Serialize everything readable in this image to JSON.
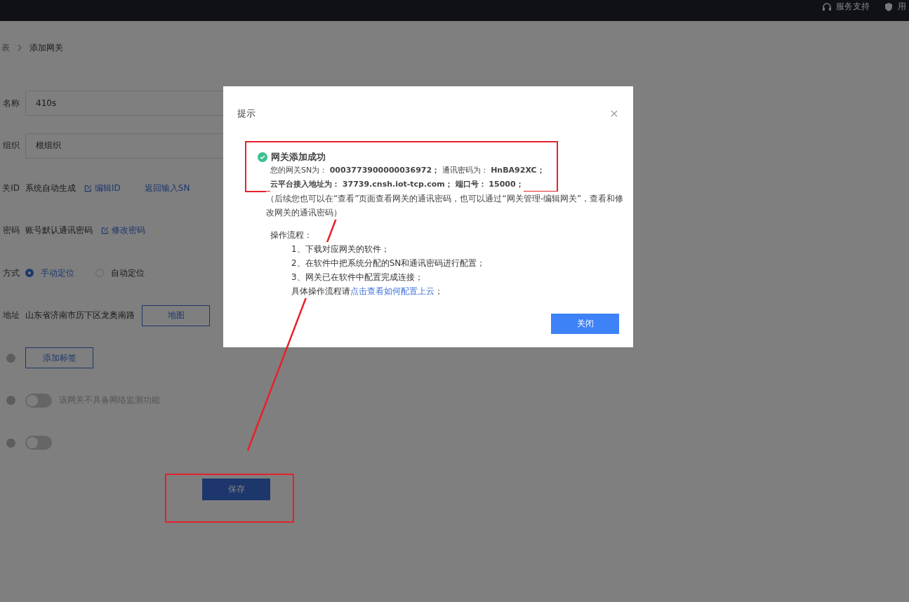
{
  "header": {
    "items": [
      "服务支持",
      "用"
    ]
  },
  "breadcrumb": [
    "表",
    "添加网关"
  ],
  "form": [
    {
      "kind": "input",
      "label": "名称",
      "value": "410s"
    },
    {
      "kind": "select",
      "label": "组织",
      "value": "根组织"
    },
    {
      "kind": "text-links",
      "label": "关ID",
      "text": "系统自动生成",
      "links": [
        {
          "text": "编辑ID",
          "icon": true
        },
        {
          "text": "返回输入SN",
          "icon": false
        }
      ]
    },
    {
      "kind": "text-links",
      "label": "密码",
      "text": "账号默认通讯密码",
      "links": [
        {
          "text": "修改密码",
          "icon": true
        }
      ]
    },
    {
      "kind": "radio",
      "label": "方式",
      "options": [
        {
          "text": "手动定位",
          "selected": true
        },
        {
          "text": "自动定位",
          "selected": false
        }
      ]
    },
    {
      "kind": "address",
      "label": "地址",
      "text": "山东省济南市历下区龙奥南路",
      "button": "地图"
    },
    {
      "kind": "tag-button",
      "button": "添加标签"
    },
    {
      "kind": "switch",
      "on": false,
      "text": "该网关不具备网络监测功能"
    },
    {
      "kind": "switch",
      "on": false
    }
  ],
  "save_button": "保存",
  "dialog": {
    "title": "提示",
    "success_title": "网关添加成功",
    "lines": [
      {
        "text": "您的网关SN为： **0003773900000036972；** 通讯密码为： **HnBA92XC；**",
        "bold": false
      },
      {
        "text": "云平台接入地址为： 37739.cnsh.iot-tcp.com； 端口号： 15000；",
        "bold": true
      }
    ],
    "note": "（后续您也可以在“查看”页面查看网关的通讯密码，也可以通过“网关管理-编辑网关”，查看和修改网关的通讯密码）",
    "steps_title": "操作流程：",
    "steps": [
      "1、下载对应网关的软件；",
      "2、在软件中把系统分配的SN和通讯密码进行配置；",
      "3、网关已在软件中配置完成连接；"
    ],
    "help_prefix": "具体操作流程请",
    "help_link": "点击查看如何配置上云",
    "help_suffix": "；",
    "close_button": "关闭"
  }
}
